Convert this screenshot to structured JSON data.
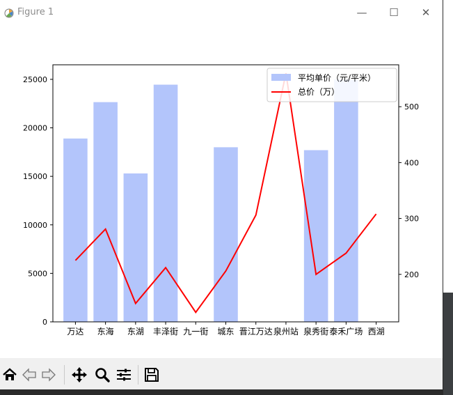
{
  "window": {
    "title": "Figure 1",
    "minimize_glyph": "—",
    "maximize_glyph": "☐",
    "close_glyph": "✕"
  },
  "toolbar": {
    "buttons": [
      {
        "name": "home-button",
        "icon": "home-icon"
      },
      {
        "name": "back-button",
        "icon": "back-arrow-icon"
      },
      {
        "name": "forward-button",
        "icon": "forward-arrow-icon"
      },
      {
        "name": "pan-button",
        "icon": "move-icon"
      },
      {
        "name": "zoom-button",
        "icon": "magnifier-icon"
      },
      {
        "name": "configure-subplots-button",
        "icon": "sliders-icon"
      },
      {
        "name": "save-button",
        "icon": "floppy-disk-icon"
      }
    ]
  },
  "colors": {
    "bar": "#b3c5fb",
    "line": "#ff0000",
    "background": "#ffffff"
  },
  "chart_data": {
    "type": "bar",
    "categories": [
      "万达",
      "东海",
      "东湖",
      "丰泽街",
      "九一街",
      "城东",
      "晋江万达",
      "泉州站",
      "泉秀街",
      "泰禾广场",
      "西湖"
    ],
    "series": [
      {
        "name": "平均单价（元/平米）",
        "type": "bar",
        "axis": "left",
        "values": [
          18900,
          22650,
          15300,
          24450,
          null,
          18000,
          null,
          null,
          17700,
          25000,
          null
        ]
      },
      {
        "name": "总价（万）",
        "type": "line",
        "axis": "right",
        "values": [
          225,
          281,
          148,
          212,
          132,
          206,
          306,
          560,
          200,
          238,
          308
        ]
      }
    ],
    "y_left": {
      "ylim": [
        0,
        26500
      ],
      "ticks": [
        "0",
        "5000",
        "10000",
        "15000",
        "20000",
        "25000"
      ]
    },
    "y_right": {
      "ylim": [
        115,
        575
      ],
      "ticks": [
        "200",
        "300",
        "400",
        "500"
      ]
    },
    "legend": "top-right",
    "grid": false
  }
}
